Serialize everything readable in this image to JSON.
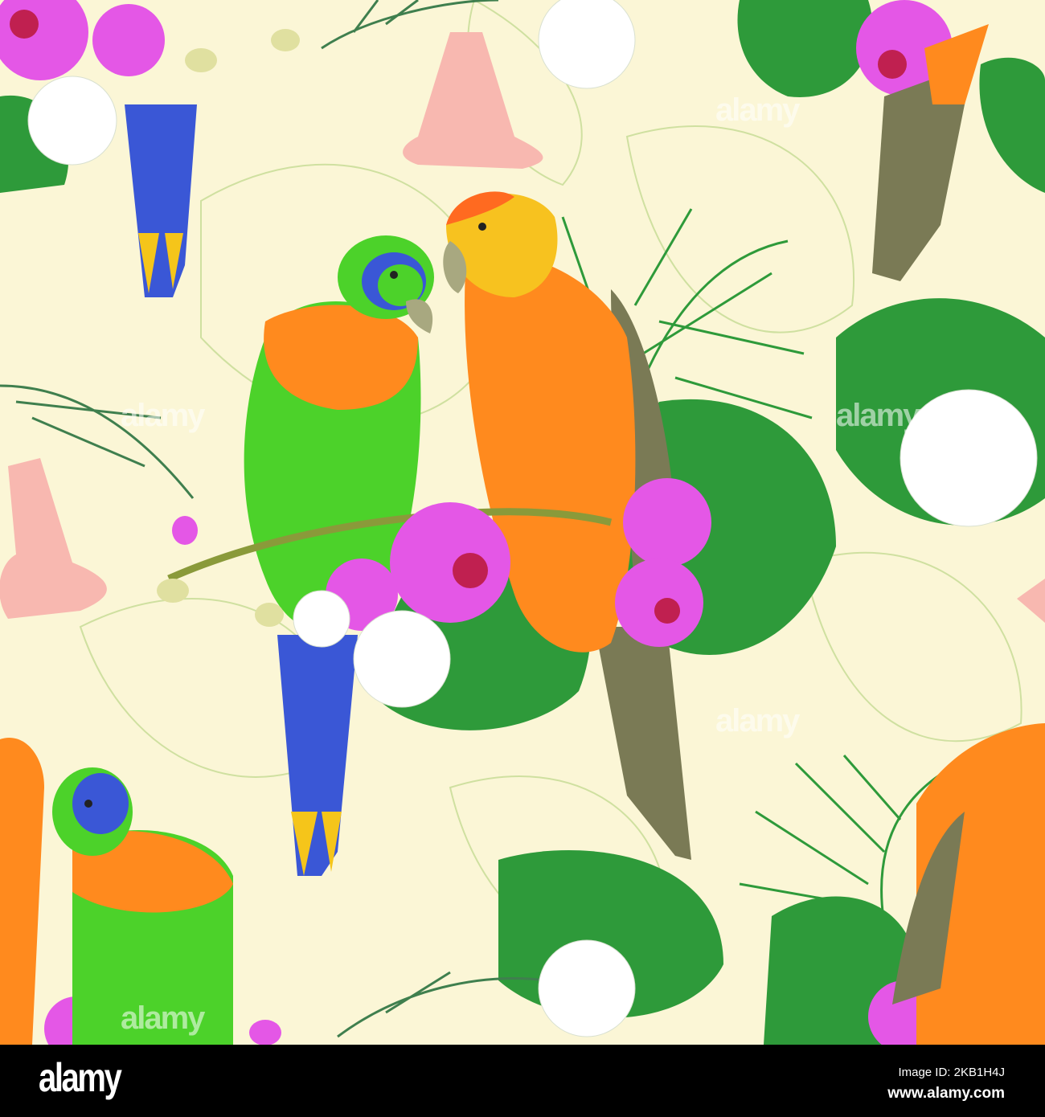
{
  "illustration": {
    "subject": "Seamless pattern: parrots with orchids and tropical leaves",
    "colors": {
      "background": "#fbf6d6",
      "outline_leaf": "#cfe0a0",
      "leaf": "#2e9a3a",
      "leaf_dark": "#1f7a2b",
      "orchid": "#e457e6",
      "white_flower": "#ffffff",
      "trumpet": "#f8b8b0",
      "parrot_green": "#4cd22a",
      "parrot_orange": "#ff8a1e",
      "parrot_blue": "#3a57d6",
      "parrot_tail_grey": "#7a7a55"
    }
  },
  "watermark": {
    "text": "alamy"
  },
  "footer": {
    "logo": "alamy",
    "image_id": "Image ID: 2KB1H4J",
    "url": "www.alamy.com"
  }
}
